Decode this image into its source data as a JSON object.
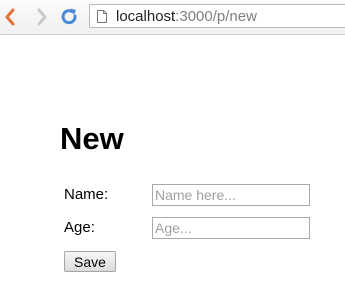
{
  "browser": {
    "url_host": "localhost",
    "url_path": ":3000/p/new",
    "icons": {
      "back": "back-arrow-icon",
      "forward": "forward-arrow-icon",
      "reload": "reload-icon",
      "page": "page-icon"
    }
  },
  "form": {
    "title": "New",
    "name_label": "Name:",
    "name_placeholder": "Name here...",
    "name_value": "",
    "age_label": "Age:",
    "age_placeholder": "Age...",
    "age_value": "",
    "submit_label": "Save"
  },
  "colors": {
    "back_arrow": "#e5743d",
    "forward_arrow": "#c9c9c9",
    "reload": "#4a88d8"
  }
}
